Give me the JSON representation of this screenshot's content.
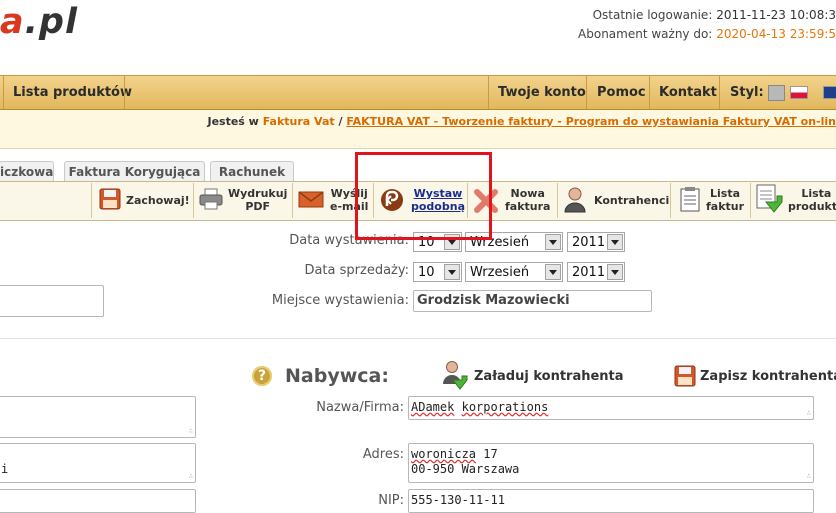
{
  "header": {
    "logo_main": "a",
    "logo_suffix": ".pl",
    "last_login_label": "Ostatnie logowanie:",
    "last_login_value": "2011-11-23 10:08:3",
    "subscription_label": "Abonament ważny do:",
    "subscription_value": "2020-04-13 23:59:5",
    "accent_color": "#e8760a"
  },
  "nav": {
    "products": "Lista produktów",
    "account": "Twoje konto",
    "help": "Pomoc",
    "contact": "Kontakt",
    "style": "Styl:"
  },
  "breadcrumb": {
    "prefix": "Jesteś w",
    "section": "Faktura Vat",
    "separator": "/",
    "page": "FAKTURA VAT - Tworzenie faktury - Program do wystawiania Faktury VAT on-lin"
  },
  "tabs": [
    "iczkowa",
    "Faktura Korygująca",
    "Rachunek"
  ],
  "toolbar": {
    "save": "Zachowaj!",
    "print_l1": "Wydrukuj",
    "print_l2": "PDF",
    "email_l1": "Wyślij",
    "email_l2": "e-mail",
    "similar_l1": "Wystaw",
    "similar_l2": "podobną",
    "new_l1": "Nowa",
    "new_l2": "faktura",
    "contractors": "Kontrahenci",
    "invoices_l1": "Lista",
    "invoices_l2": "faktur",
    "products_l1": "Lista",
    "products_l2": "produktó"
  },
  "form": {
    "issue_date_label": "Data wystawienia:",
    "sale_date_label": "Data sprzedaży:",
    "place_label": "Miejsce wystawienia:",
    "issue_day": "10",
    "issue_month": "Wrzesień",
    "issue_year": "2011",
    "sale_day": "10",
    "sale_month": "Wrzesień",
    "sale_year": "2011",
    "place_value": "Grodzisk Mazowiecki"
  },
  "buyer": {
    "title": "Nabywca:",
    "help_glyph": "?",
    "load_contractor": "Załaduj kontrahenta",
    "save_contractor": "Zapisz kontrahenta",
    "name_label": "Nazwa/Firma:",
    "name_word1": "ADamek",
    "name_word2": "korporations",
    "address_label": "Adres:",
    "address_street": "woronicza",
    "address_number": "17",
    "address_line2": "00-950 Warszawa",
    "nip_label": "NIP:",
    "nip_value": "555-130-11-11"
  },
  "left_fragment": {
    "textarea_char": "i"
  },
  "highlight_color": "#e0141c"
}
